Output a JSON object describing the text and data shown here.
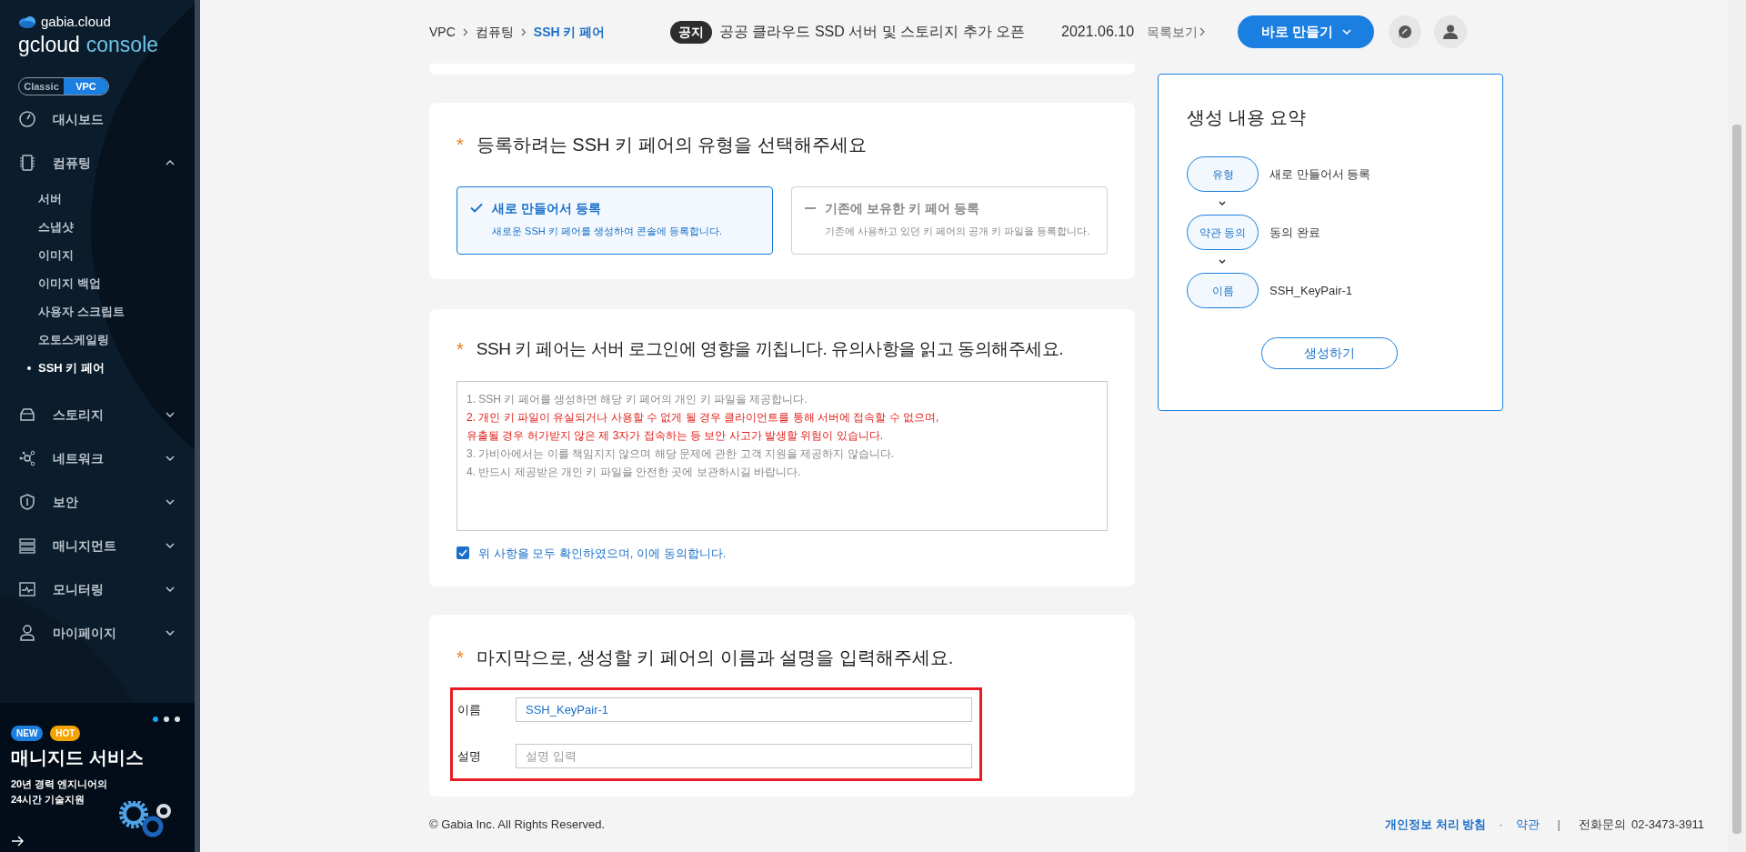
{
  "sidebar": {
    "brand": "gabia.cloud",
    "product": "gcloud",
    "product_suffix": "console",
    "modes": [
      {
        "label": "Classic",
        "selected": false
      },
      {
        "label": "VPC",
        "selected": true
      }
    ],
    "items": [
      {
        "kind": "dashboard",
        "label": "대시보드"
      },
      {
        "kind": "computing",
        "label": "컴퓨팅",
        "expanded": true,
        "children": [
          {
            "label": "서버",
            "selected": false
          },
          {
            "label": "스냅샷",
            "selected": false
          },
          {
            "label": "이미지",
            "selected": false
          },
          {
            "label": "이미지 백업",
            "selected": false
          },
          {
            "label": "사용자 스크립트",
            "selected": false
          },
          {
            "label": "오토스케일링",
            "selected": false
          },
          {
            "label": "SSH 키 페어",
            "selected": true
          }
        ]
      },
      {
        "kind": "storage",
        "label": "스토리지",
        "expanded": false
      },
      {
        "kind": "network",
        "label": "네트워크",
        "expanded": false
      },
      {
        "kind": "security",
        "label": "보안",
        "expanded": false
      },
      {
        "kind": "management",
        "label": "매니지먼트",
        "expanded": false
      },
      {
        "kind": "monitoring",
        "label": "모니터링",
        "expanded": false
      },
      {
        "kind": "mypage",
        "label": "마이페이지",
        "expanded": false
      }
    ],
    "banner": {
      "pager": [
        {
          "selected": true
        },
        {
          "selected": false
        },
        {
          "selected": false
        }
      ],
      "badges": [
        {
          "label": "NEW",
          "color": "#1a7fe0"
        },
        {
          "label": "HOT",
          "color": "#f5a300"
        }
      ],
      "title": "매니지드 서비스",
      "lines": [
        "20년 경력 엔지니어의",
        "24시간 기술지원"
      ]
    }
  },
  "header": {
    "breadcrumb": [
      {
        "label": "VPC",
        "selected": false
      },
      {
        "label": "컴퓨팅",
        "selected": false
      },
      {
        "label": "SSH 키 페어",
        "selected": true
      }
    ],
    "notice": {
      "tag": "공지",
      "text": "공공 클라우드 SSD 서버 및 스토리지 추가 오픈",
      "date": "2021.06.10",
      "more": "목록보기"
    },
    "create_button": "바로 만들기"
  },
  "type_section": {
    "required_mark": "*",
    "title": "등록하려는 SSH 키 페어의 유형을 선택해주세요",
    "options": [
      {
        "title": "새로 만들어서 등록",
        "description": "새로운 SSH 키 페어를 생성하여 콘솔에 등록합니다.",
        "selected": true
      },
      {
        "title": "기존에 보유한 키 페어 등록",
        "description": "기존에 사용하고 있던 키 페어의 공개 키 파일을 등록합니다.",
        "selected": false
      }
    ]
  },
  "terms_section": {
    "required_mark": "*",
    "title": "SSH 키 페어는 서버 로그인에 영향을 끼칩니다. 유의사항을 읽고 동의해주세요.",
    "lines": [
      {
        "text": "1. SSH 키 페어를 생성하면 해당 키 페어의 개인 키 파일을 제공합니다.",
        "warning": false
      },
      {
        "text": "2. 개인 키 파일이 유실되거나 사용할 수 없게 될 경우 클라이언트를 통해 서버에 접속할 수 없으며,",
        "warning": true
      },
      {
        "text": "유출될 경우 허가받지 않은 제 3자가 접속하는 등 보안 사고가 발생할 위험이 있습니다.",
        "warning": true
      },
      {
        "text": "3. 가비아에서는 이를 책임지지 않으며 해당 문제에 관한 고객 지원을 제공하지 않습니다.",
        "warning": false
      },
      {
        "text": "4. 반드시 제공받은 개인 키 파일을 안전한 곳에 보관하시길 바랍니다.",
        "warning": false
      }
    ],
    "agree": {
      "label": "위 사항을 모두 확인하였으며, 이에 동의합니다.",
      "checked": true
    }
  },
  "name_section": {
    "required_mark": "*",
    "title": "마지막으로, 생성할 키 페어의 이름과 설명을 입력해주세요.",
    "highlighted": true,
    "fields": [
      {
        "label": "이름",
        "value": "SSH_KeyPair-1"
      },
      {
        "label": "설명",
        "placeholder": "설명 입력"
      }
    ]
  },
  "summary": {
    "title": "생성 내용 요약",
    "steps": [
      {
        "label": "유형",
        "value": "새로 만들어서 등록"
      },
      {
        "label": "약관 동의",
        "value": "동의 완료"
      },
      {
        "label": "이름",
        "value": "SSH_KeyPair-1"
      }
    ],
    "button": "생성하기"
  },
  "footer": {
    "copyright": "© Gabia Inc. All Rights Reserved.",
    "links": [
      "개인정보 처리 방침",
      "약관"
    ],
    "dot": "·",
    "bar": "|",
    "phone_label": "전화문의",
    "phone": "02-3473-3911"
  }
}
